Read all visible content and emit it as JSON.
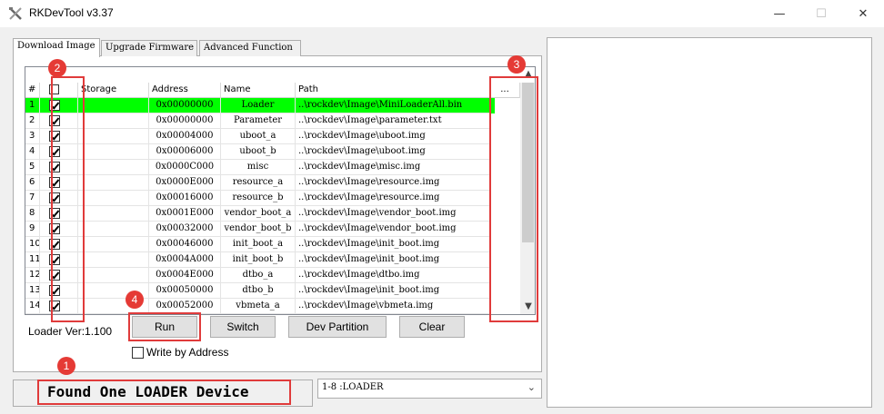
{
  "window": {
    "title": "RKDevTool v3.37",
    "minimize_glyph": "—",
    "maximize_glyph": "☐",
    "close_glyph": "✕"
  },
  "tabs": [
    {
      "label": "Download Image",
      "active": true
    },
    {
      "label": "Upgrade Firmware",
      "active": false
    },
    {
      "label": "Advanced Function",
      "active": false
    }
  ],
  "grid": {
    "columns": [
      "#",
      "",
      "Storage",
      "Address",
      "Name",
      "Path",
      "..."
    ],
    "rows": [
      {
        "num": "1",
        "checked": true,
        "storage": "",
        "address": "0x00000000",
        "name": "Loader",
        "path": "..\\rockdev\\Image\\MiniLoaderAll.bin",
        "selected": true
      },
      {
        "num": "2",
        "checked": true,
        "storage": "",
        "address": "0x00000000",
        "name": "Parameter",
        "path": "..\\rockdev\\Image\\parameter.txt"
      },
      {
        "num": "3",
        "checked": true,
        "storage": "",
        "address": "0x00004000",
        "name": "uboot_a",
        "path": "..\\rockdev\\Image\\uboot.img"
      },
      {
        "num": "4",
        "checked": true,
        "storage": "",
        "address": "0x00006000",
        "name": "uboot_b",
        "path": "..\\rockdev\\Image\\uboot.img"
      },
      {
        "num": "5",
        "checked": true,
        "storage": "",
        "address": "0x0000C000",
        "name": "misc",
        "path": "..\\rockdev\\Image\\misc.img"
      },
      {
        "num": "6",
        "checked": true,
        "storage": "",
        "address": "0x0000E000",
        "name": "resource_a",
        "path": "..\\rockdev\\Image\\resource.img"
      },
      {
        "num": "7",
        "checked": true,
        "storage": "",
        "address": "0x00016000",
        "name": "resource_b",
        "path": "..\\rockdev\\Image\\resource.img"
      },
      {
        "num": "8",
        "checked": true,
        "storage": "",
        "address": "0x0001E000",
        "name": "vendor_boot_a",
        "path": "..\\rockdev\\Image\\vendor_boot.img"
      },
      {
        "num": "9",
        "checked": true,
        "storage": "",
        "address": "0x00032000",
        "name": "vendor_boot_b",
        "path": "..\\rockdev\\Image\\vendor_boot.img"
      },
      {
        "num": "10",
        "checked": true,
        "storage": "",
        "address": "0x00046000",
        "name": "init_boot_a",
        "path": "..\\rockdev\\Image\\init_boot.img"
      },
      {
        "num": "11",
        "checked": true,
        "storage": "",
        "address": "0x0004A000",
        "name": "init_boot_b",
        "path": "..\\rockdev\\Image\\init_boot.img"
      },
      {
        "num": "12",
        "checked": true,
        "storage": "",
        "address": "0x0004E000",
        "name": "dtbo_a",
        "path": "..\\rockdev\\Image\\dtbo.img"
      },
      {
        "num": "13",
        "checked": true,
        "storage": "",
        "address": "0x00050000",
        "name": "dtbo_b",
        "path": "..\\rockdev\\Image\\init_boot.img"
      },
      {
        "num": "14",
        "checked": true,
        "storage": "",
        "address": "0x00052000",
        "name": "vbmeta_a",
        "path": "..\\rockdev\\Image\\vbmeta.img"
      }
    ],
    "selected_row_color": "#00ff00"
  },
  "controls": {
    "loader_ver": "Loader Ver:1.100",
    "run": "Run",
    "switch": "Switch",
    "dev_partition": "Dev Partition",
    "clear": "Clear",
    "write_by_address": "Write by Address"
  },
  "status": {
    "text": "Found One LOADER Device",
    "device_select": "1-8 :LOADER"
  },
  "annotations": {
    "color": "#e03b3b",
    "badges": [
      "1",
      "2",
      "3",
      "4"
    ]
  }
}
